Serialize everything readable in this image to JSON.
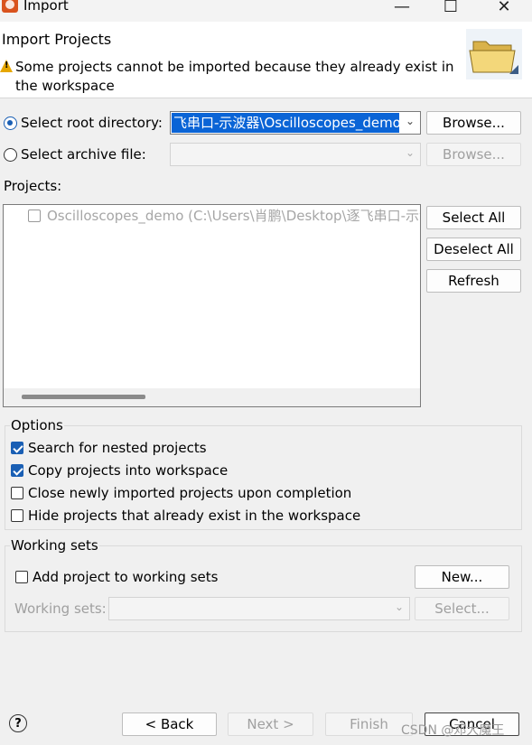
{
  "window": {
    "title": "Import"
  },
  "header": {
    "title": "Import Projects",
    "message": "Some projects cannot be imported because they already exist in the workspace"
  },
  "source": {
    "root_label": "Select root directory:",
    "root_value": "飞串口-示波器\\Oscilloscopes_demo",
    "root_browse": "Browse...",
    "archive_label": "Select archive file:",
    "archive_value": "",
    "archive_browse": "Browse..."
  },
  "projects": {
    "label": "Projects:",
    "items": [
      {
        "name": "Oscilloscopes_demo (C:\\Users\\肖鹏\\Desktop\\逐飞串口-示波",
        "checked": false,
        "enabled": false
      }
    ],
    "select_all": "Select All",
    "deselect_all": "Deselect All",
    "refresh": "Refresh"
  },
  "options": {
    "title": "Options",
    "items": [
      {
        "label": "Search for nested projects",
        "checked": true
      },
      {
        "label": "Copy projects into workspace",
        "checked": true
      },
      {
        "label": "Close newly imported projects upon completion",
        "checked": false
      },
      {
        "label": "Hide projects that already exist in the workspace",
        "checked": false
      }
    ]
  },
  "working_sets": {
    "title": "Working sets",
    "add_label": "Add project to working sets",
    "add_checked": false,
    "new_button": "New...",
    "sets_label": "Working sets:",
    "sets_value": "",
    "select_button": "Select..."
  },
  "footer": {
    "help": "?",
    "back": "< Back",
    "next": "Next >",
    "finish": "Finish",
    "cancel": "Cancel"
  },
  "watermark": "CSDN @邓大魔王",
  "colors": {
    "accent": "#1a5fb4",
    "selection": "#0a64d6",
    "warning": "#e6a700"
  }
}
